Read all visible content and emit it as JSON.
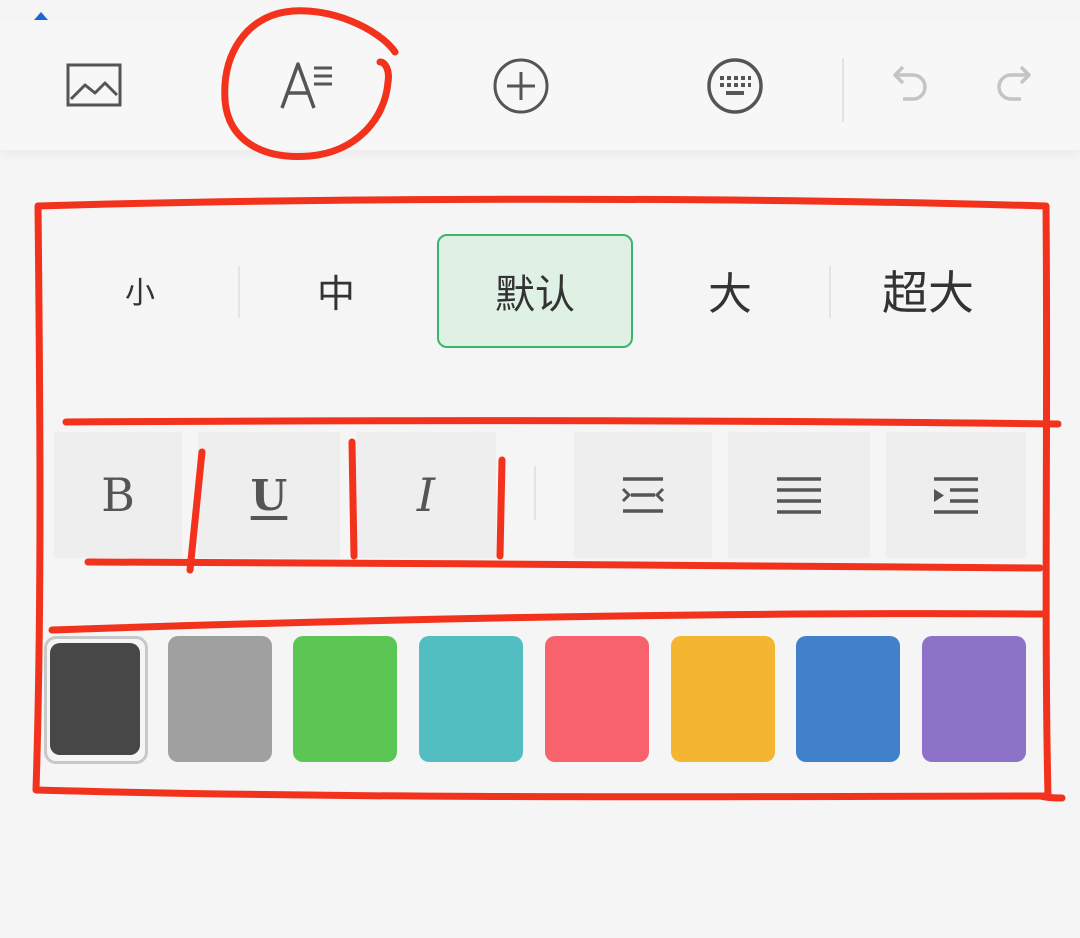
{
  "toolbar": {
    "items": [
      {
        "name": "image-icon"
      },
      {
        "name": "text-format-icon"
      },
      {
        "name": "add-circle-icon"
      },
      {
        "name": "keyboard-icon"
      },
      {
        "name": "undo-icon"
      },
      {
        "name": "redo-icon"
      }
    ]
  },
  "font_size": {
    "options": [
      "小",
      "中",
      "默认",
      "大",
      "超大"
    ],
    "selected": "默认"
  },
  "text_style": {
    "bold": "B",
    "underline": "U",
    "italic": "I"
  },
  "alignment": {
    "items": [
      "align-center-icon",
      "align-justify-icon",
      "indent-icon"
    ]
  },
  "colors": {
    "swatches": [
      "#474747",
      "#a0a0a0",
      "#5bc653",
      "#52bec2",
      "#f7626c",
      "#f4b530",
      "#4181cb",
      "#8c73c8"
    ],
    "selected": "#474747"
  },
  "accent": {
    "selected_bg": "#dff1e4",
    "selected_border": "#38b76b",
    "annotation": "#f2321c"
  }
}
